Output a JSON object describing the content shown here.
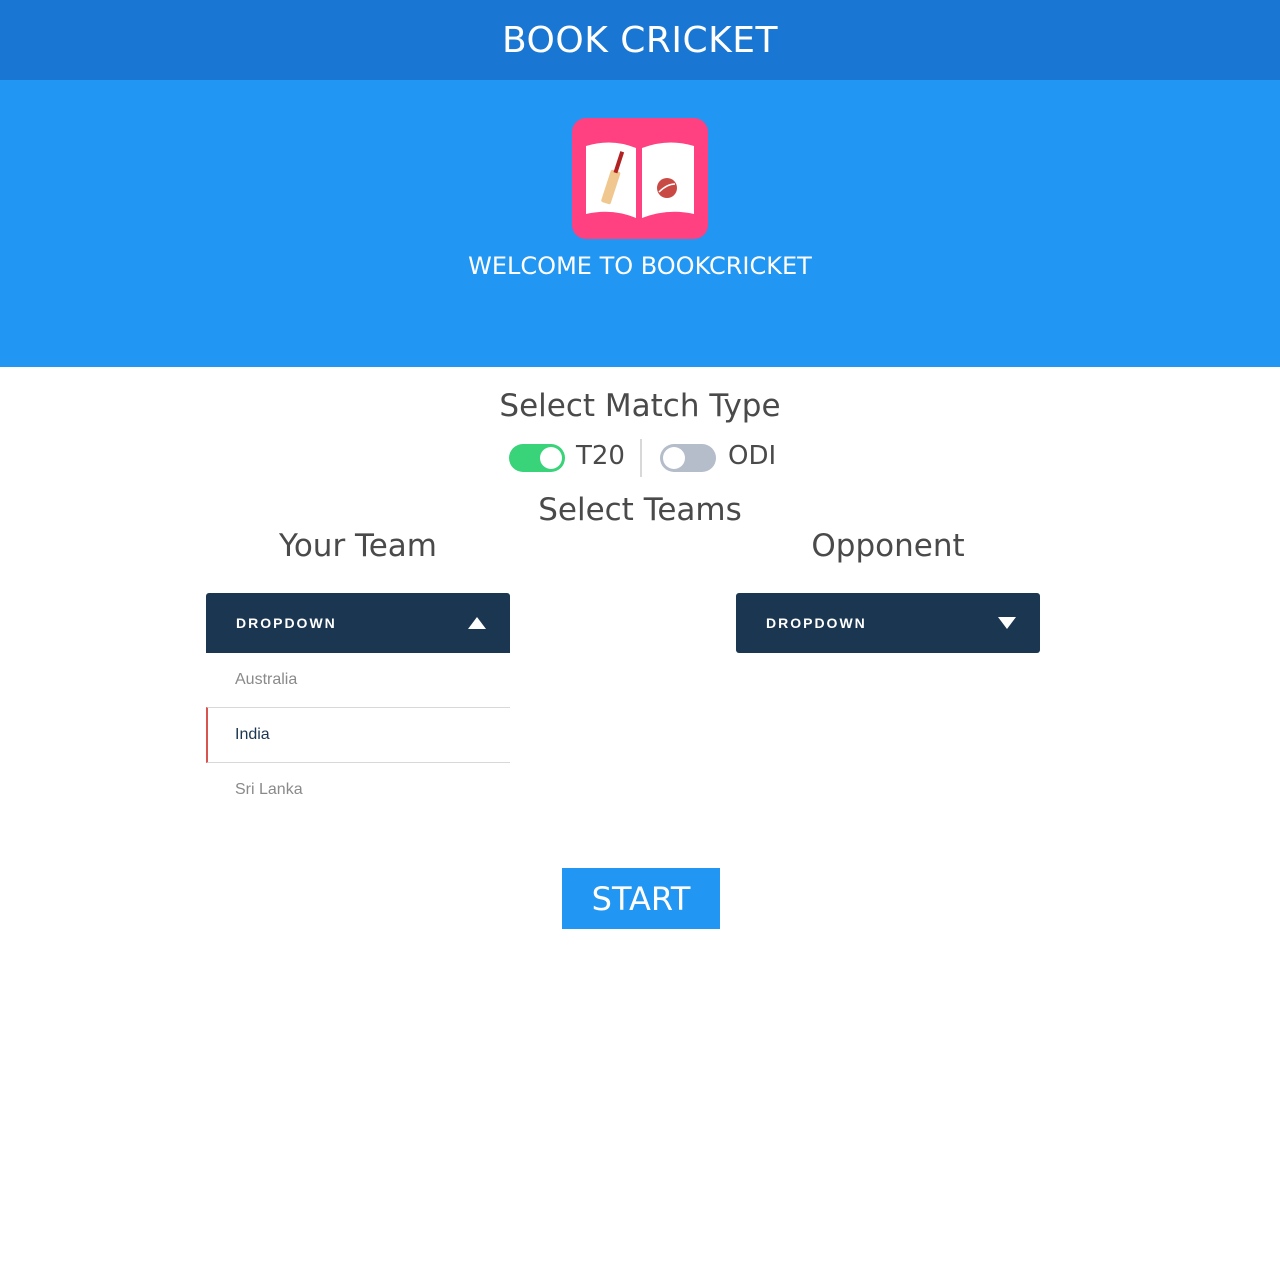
{
  "header": {
    "title": "BOOK CRICKET"
  },
  "hero": {
    "logo_icon": "book-cricket-icon",
    "welcome": "WELCOME TO BOOKCRICKET",
    "colors": {
      "background": "#2196f3",
      "logo": "#ff4081"
    }
  },
  "match_type": {
    "heading": "Select Match Type",
    "options": [
      {
        "label": "T20",
        "on": true
      },
      {
        "label": "ODI",
        "on": false
      }
    ]
  },
  "teams": {
    "heading": "Select Teams",
    "your_team": {
      "heading": "Your Team",
      "dropdown_label": "DROPDOWN",
      "open": true,
      "options": [
        "Australia",
        "India",
        "Sri Lanka"
      ],
      "selected": "India"
    },
    "opponent": {
      "heading": "Opponent",
      "dropdown_label": "DROPDOWN",
      "open": false
    }
  },
  "start_label": "START",
  "colors": {
    "header": "#1976d2",
    "toggle_on": "#39d37a",
    "toggle_off": "#b4bdc9",
    "dropdown": "#1a3650"
  }
}
